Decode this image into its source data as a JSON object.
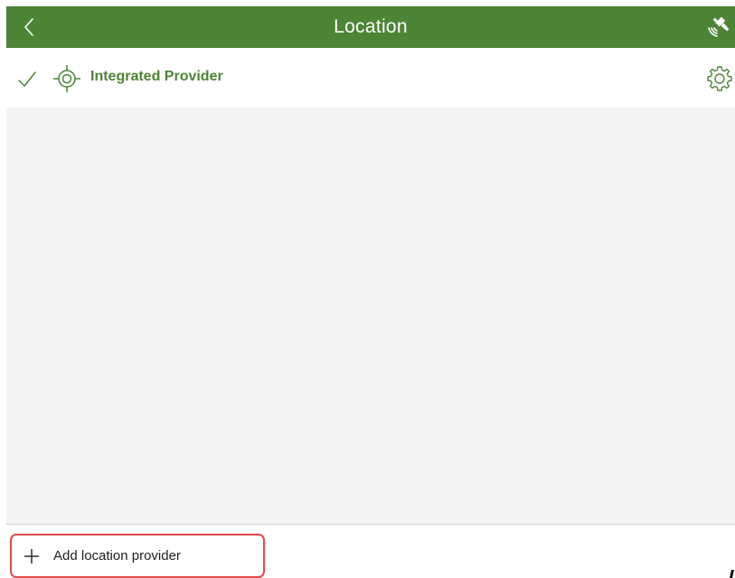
{
  "header": {
    "title": "Location",
    "back_icon": "chevron-left-icon",
    "gps_icon": "satellite-signal-icon",
    "background_color": "#4d8536"
  },
  "providers": [
    {
      "label": "Integrated Provider",
      "selected": true,
      "check_icon": "checkmark-icon",
      "type_icon": "crosshair-target-icon",
      "settings_icon": "gear-icon",
      "color": "#4d8536"
    }
  ],
  "footer": {
    "add_label": "Add location provider",
    "add_icon": "plus-icon",
    "highlight_color": "#e04a4a"
  }
}
